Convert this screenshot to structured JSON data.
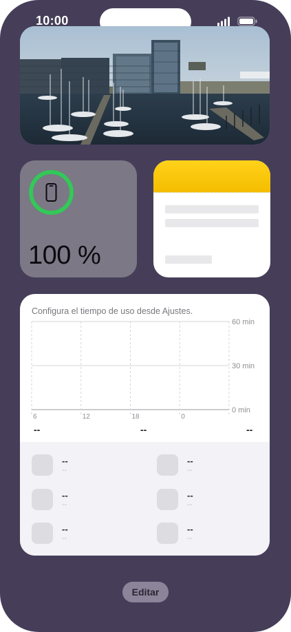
{
  "status_bar": {
    "time": "10:00",
    "signal_icon": "cellular-signal-icon",
    "battery_icon": "battery-icon"
  },
  "photo_widget": {
    "description_icon": "photo-harbor-image"
  },
  "battery_widget": {
    "level_text": "100 %",
    "level": 1.0,
    "ring_color": "#34c759",
    "device_icon": "iphone-icon"
  },
  "notes_widget": {
    "header_color": "#ffcc00"
  },
  "screen_time_widget": {
    "caption": "Configura el tiempo de uso desde Ajustes.",
    "summary": [
      "--",
      "--",
      "--"
    ],
    "apps": [
      {
        "name": "--",
        "time": "--"
      },
      {
        "name": "--",
        "time": "--"
      },
      {
        "name": "--",
        "time": "--"
      },
      {
        "name": "--",
        "time": "--"
      },
      {
        "name": "--",
        "time": "--"
      },
      {
        "name": "--",
        "time": "--"
      }
    ]
  },
  "chart_data": {
    "type": "bar",
    "categories": [
      "6",
      "12",
      "18",
      "0"
    ],
    "values": [],
    "y_tick_labels": [
      "60 min",
      "30 min",
      "0 min"
    ],
    "y_ticks": [
      60,
      30,
      0
    ],
    "ylim": [
      0,
      60
    ],
    "grid": true
  },
  "footer": {
    "edit_label": "Editar"
  }
}
